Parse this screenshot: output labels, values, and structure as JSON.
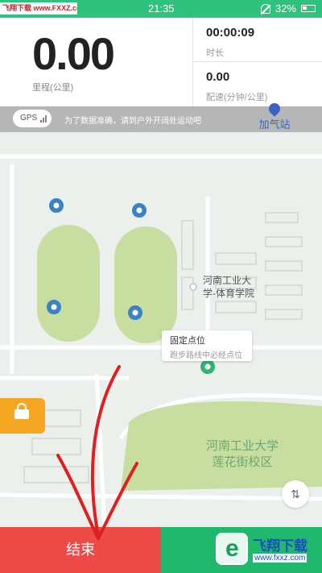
{
  "status_bar": {
    "watermark_text": "飞翔下载 www.FXXZ.com",
    "time": "21:35",
    "battery": "32%"
  },
  "stats": {
    "distance": {
      "value": "0.00",
      "label": "里程(公里)"
    },
    "duration": {
      "value": "00:00:09",
      "label": "时长"
    },
    "pace": {
      "value": "0.00",
      "label": "配速(分钟/公里)"
    }
  },
  "gps_banner": {
    "badge": "GPS",
    "tip": "为了数据准确，请到户外开阔处运动吧",
    "gas_station_label": "加气站"
  },
  "map": {
    "poi_label": "河南工业大学-体育学院",
    "poi_line1": "河南工业大",
    "poi_line2": "学-体育学院",
    "campus_line1": "河南工业大学",
    "campus_line2": "莲花街校区",
    "bubble_title": "固定点位",
    "bubble_subtitle": "跑步路线中必经点位"
  },
  "controls": {
    "end_label": "结束"
  },
  "corner_watermark": {
    "text": "飞翔下载",
    "url": "www.fxxz.com"
  },
  "colors": {
    "accent_green": "#1fb86d",
    "end_red": "#ed4a48",
    "lock_orange": "#f5a623",
    "park_green": "#c8dea0"
  },
  "icons": {
    "lock": "lock-icon",
    "location_switch": "updown-arrows-icon",
    "marker": "map-pin-icon"
  }
}
